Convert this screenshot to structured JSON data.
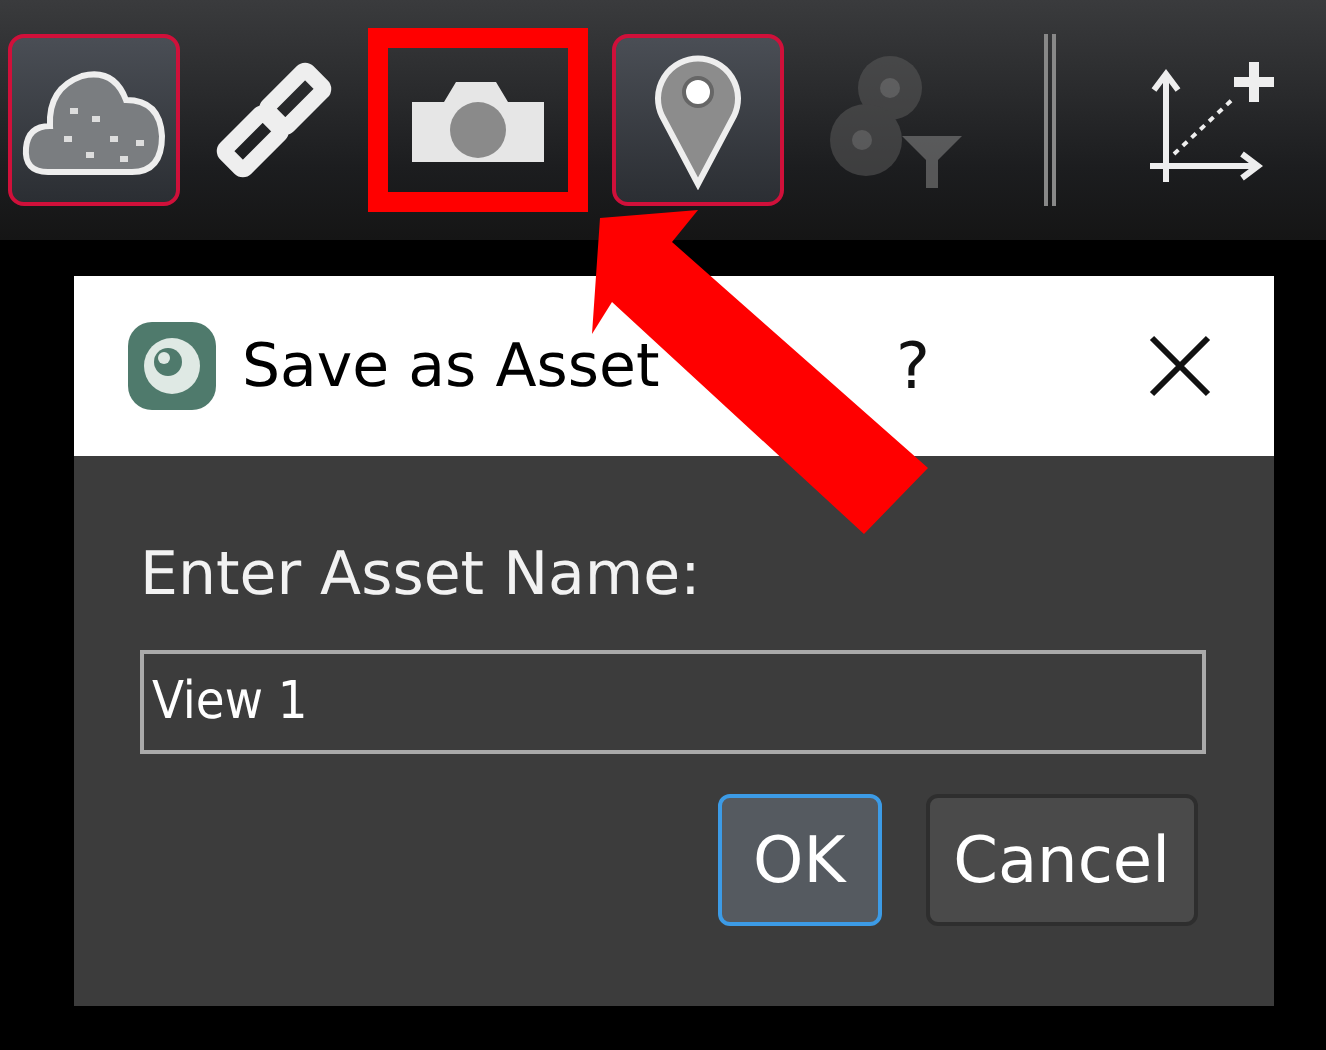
{
  "toolbar": {
    "tools": [
      {
        "kind": "cloud",
        "selected": true,
        "disabled": false,
        "highlighted": false
      },
      {
        "kind": "link",
        "selected": false,
        "disabled": false,
        "highlighted": false
      },
      {
        "kind": "camera",
        "selected": false,
        "disabled": false,
        "highlighted": true
      },
      {
        "kind": "pin",
        "selected": true,
        "disabled": false,
        "highlighted": false
      },
      {
        "kind": "filter",
        "selected": false,
        "disabled": true,
        "highlighted": false
      },
      {
        "kind": "separator"
      },
      {
        "kind": "axes",
        "selected": false,
        "disabled": false,
        "highlighted": false
      }
    ]
  },
  "dialog": {
    "title": "Save as Asset",
    "help_button": "?",
    "label": "Enter Asset Name:",
    "input": {
      "value": "View 1"
    },
    "buttons": [
      {
        "label": "OK",
        "default": true
      },
      {
        "label": "Cancel",
        "default": false
      }
    ]
  }
}
